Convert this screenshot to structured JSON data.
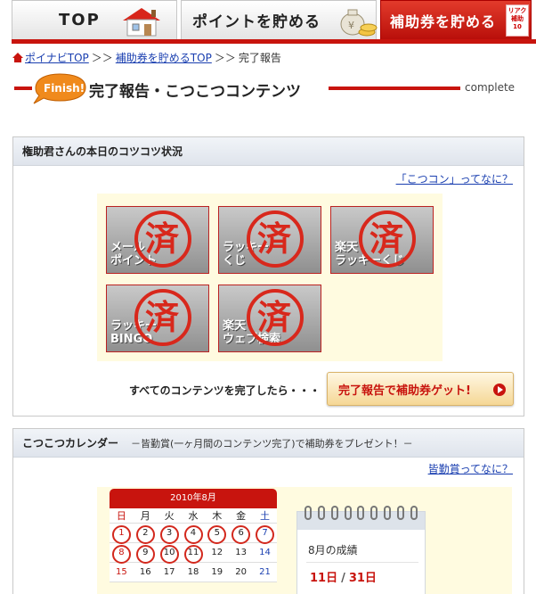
{
  "tabs": {
    "top": "TOP",
    "point": "ポイントを貯める",
    "hojo": "補助券を貯める",
    "hojo_badge": "リアクション\n補助\n10枚貯"
  },
  "breadcrumb": {
    "home": "ポイナビTOP",
    "hojo_top": "補助券を貯めるTOP",
    "sep": "＞＞",
    "current": "完了報告"
  },
  "heading": {
    "badge": "Finish!",
    "title": "完了報告・こつこつコンテンツ",
    "en": "complete"
  },
  "status_section": {
    "title": "権助君さんの本日のコツコツ状況",
    "help_link": "「こつコン」ってなに？",
    "tiles": [
      {
        "label": "メール\nポイント",
        "stamp": "済"
      },
      {
        "label": "ラッキー\nくじ",
        "stamp": "済"
      },
      {
        "label": "楽天\nラッキーくじ",
        "stamp": "済"
      },
      {
        "label": "ラッキー\nBINGO",
        "stamp": "済"
      },
      {
        "label": "楽天\nウェブ検索",
        "stamp": "済"
      }
    ],
    "complete_text": "すべてのコンテンツを完了したら・・・",
    "complete_button": "完了報告で補助券ゲット!"
  },
  "calendar_section": {
    "title": "こつこつカレンダー",
    "subtitle": "－皆勤賞(一ヶ月間のコンテンツ完了)で補助券をプレゼント！－",
    "help_link": "皆勤賞ってなに？",
    "month_title": "2010年8月",
    "weekdays": [
      "日",
      "月",
      "火",
      "水",
      "木",
      "金",
      "土"
    ],
    "rows": [
      [
        "1",
        "2",
        "3",
        "4",
        "5",
        "6",
        "7"
      ],
      [
        "8",
        "9",
        "10",
        "11",
        "12",
        "13",
        "14"
      ],
      [
        "15",
        "16",
        "17",
        "18",
        "19",
        "20",
        "21"
      ]
    ],
    "done_days": [
      "1",
      "2",
      "3",
      "4",
      "5",
      "6",
      "7",
      "8",
      "9",
      "10",
      "11"
    ],
    "memo_label": "8月の成績",
    "score_done": "11日",
    "score_total": "31日",
    "score_sep": "/"
  }
}
